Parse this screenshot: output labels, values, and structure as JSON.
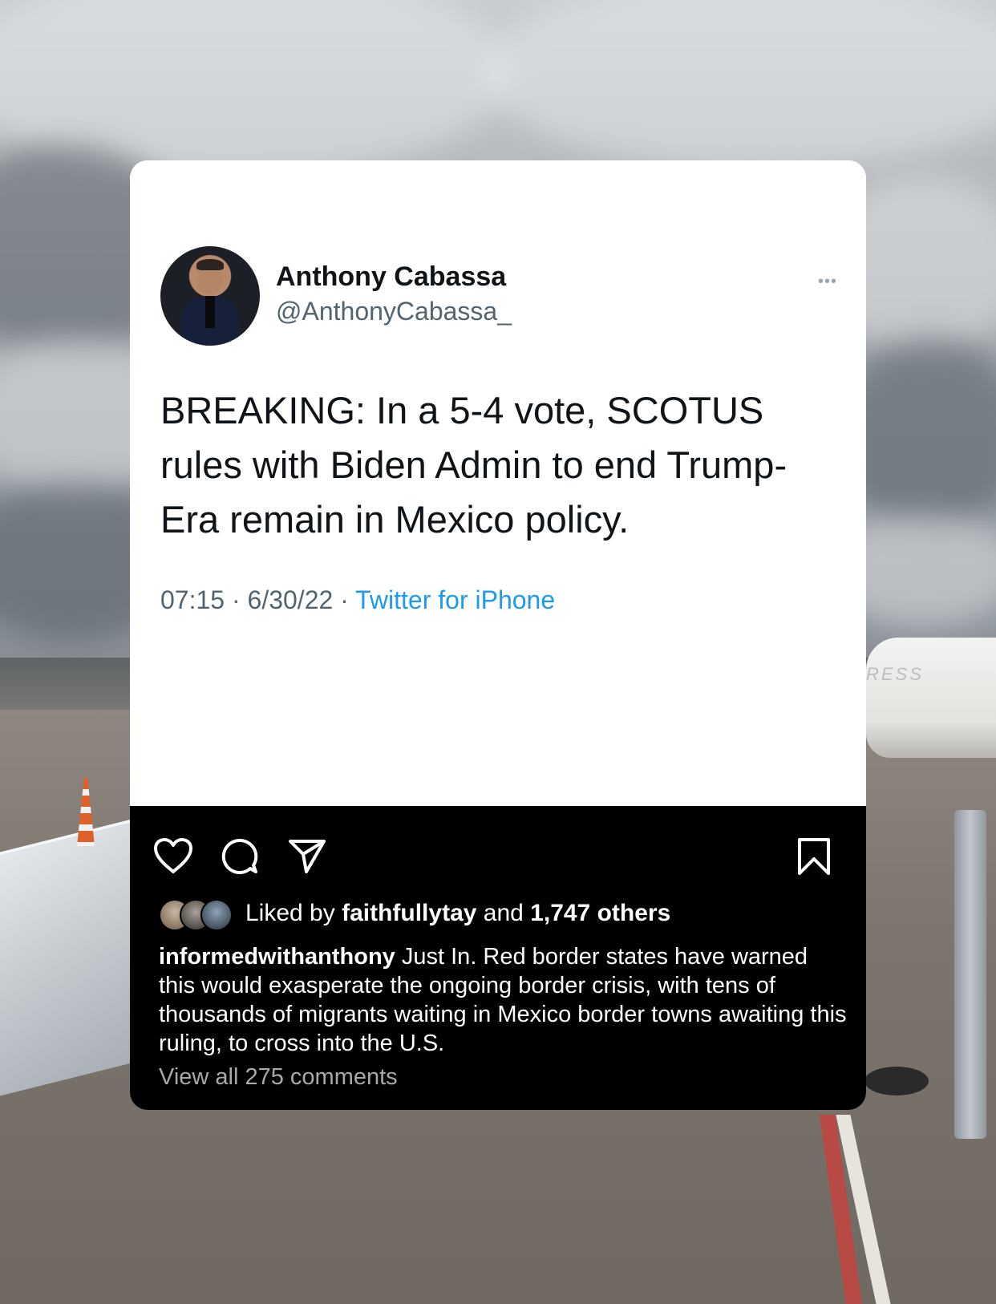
{
  "tweet": {
    "display_name": "Anthony Cabassa",
    "handle": "@AnthonyCabassa_",
    "more_glyph": "•••",
    "text": "BREAKING: In a 5-4 vote, SCOTUS rules with Biden Admin to end Trump-Era remain in Mexico policy.",
    "time": "07:15",
    "separator": " · ",
    "date": "6/30/22",
    "source": "Twitter for iPhone"
  },
  "instagram": {
    "liked_by_prefix": "Liked by ",
    "liked_by_user": "faithfullytay",
    "liked_by_and": " and ",
    "liked_by_count": "1,747 others",
    "caption_user": "informedwithanthony",
    "caption_text": " Just In. Red border states have warned this would exasperate the ongoing border crisis, with tens of thousands of migrants waiting in Mexico border towns awaiting this ruling, to cross into the U.S.",
    "view_comments": "View all 275 comments",
    "icons": [
      "heart-icon",
      "comment-icon",
      "share-icon",
      "bookmark-icon"
    ]
  },
  "background": {
    "scene_text": "RESS"
  },
  "colors": {
    "link_blue": "#1d9bf0",
    "muted_gray": "#536471",
    "insta_bg": "#000000"
  }
}
